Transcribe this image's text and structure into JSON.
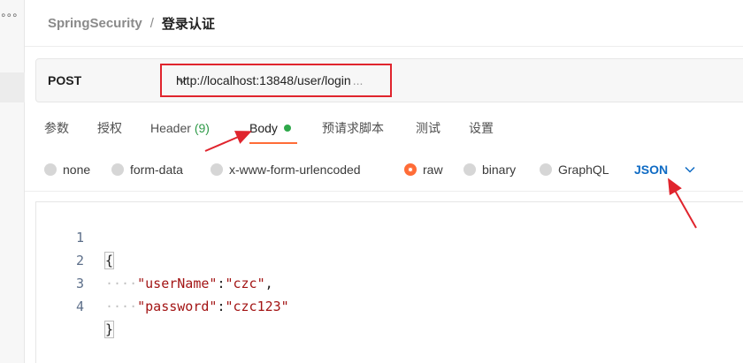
{
  "left_sidebar": {
    "menu_icon": "more-dots-icon",
    "menu_glyph": "∘∘∘"
  },
  "breadcrumb": {
    "parent": "SpringSecurity",
    "separator": "/",
    "current": "登录认证"
  },
  "request": {
    "method": "POST",
    "method_chevron_icon": "chevron-down-icon",
    "url": "http://localhost:13848/user/login",
    "url_ellipsis": "..."
  },
  "tabs": [
    {
      "label": "参数"
    },
    {
      "label": "授权"
    },
    {
      "label": "Header",
      "count": "(9)"
    },
    {
      "label": "Body",
      "active": true,
      "dot_color": "#2ea84a"
    },
    {
      "label": "预请求脚本"
    },
    {
      "label": "测试"
    },
    {
      "label": "设置"
    }
  ],
  "body_types": [
    {
      "label": "none",
      "checked": false
    },
    {
      "label": "form-data",
      "checked": false
    },
    {
      "label": "x-www-form-urlencoded",
      "checked": false
    },
    {
      "label": "raw",
      "checked": true
    },
    {
      "label": "binary",
      "checked": false
    },
    {
      "label": "GraphQL",
      "checked": false
    }
  ],
  "raw_format": {
    "label": "JSON",
    "chevron_icon": "chevron-down-icon"
  },
  "editor": {
    "line_numbers": [
      "1",
      "2",
      "3",
      "4"
    ],
    "lines": [
      {
        "brace": "{"
      },
      {
        "indent": "····",
        "key": "\"userName\"",
        "colon": ":",
        "value": "\"czc\"",
        "comma": ","
      },
      {
        "indent": "····",
        "key": "\"password\"",
        "colon": ":",
        "value": "\"czc123\""
      },
      {
        "brace": "}"
      }
    ]
  },
  "colors": {
    "accent": "#ff6c37",
    "json_blue": "#0f6bc4",
    "annotation_red": "#e0242d",
    "code_string": "#a31515",
    "success_green": "#2ea84a"
  }
}
